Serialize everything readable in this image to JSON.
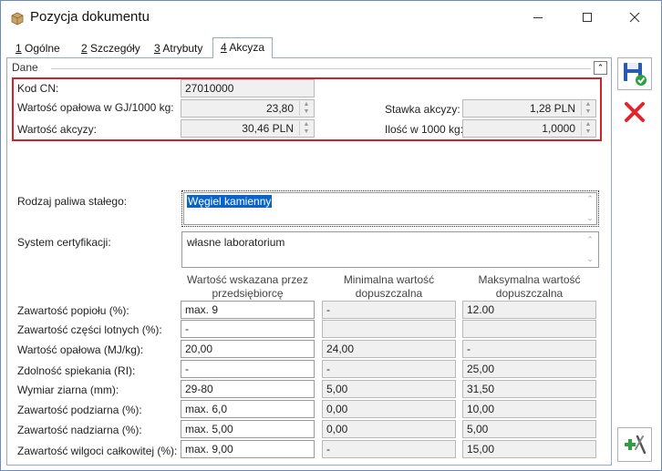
{
  "window": {
    "title": "Pozycja dokumentu"
  },
  "tabs": [
    {
      "key": "1",
      "label": " Ogólne"
    },
    {
      "key": "2",
      "label": " Szczegóły"
    },
    {
      "key": "3",
      "label": " Atrybuty"
    },
    {
      "key": "4",
      "label": " Akcyza"
    }
  ],
  "group": {
    "title": "Dane"
  },
  "excise": {
    "kod_cn_label": "Kod CN:",
    "kod_cn_value": "27010000",
    "wartosc_opalowa_label": "Wartość opałowa w GJ/1000 kg:",
    "wartosc_opalowa_value": "23,80",
    "wartosc_akcyzy_label": "Wartość akcyzy:",
    "wartosc_akcyzy_value": "30,46 PLN",
    "stawka_label": "Stawka akcyzy:",
    "stawka_value": "1,28 PLN",
    "ilosc_label": "Ilość w 1000 kg:",
    "ilosc_value": "1,0000"
  },
  "fuel": {
    "rodzaj_label": "Rodzaj paliwa stałego:",
    "rodzaj_value": "Węgiel kamienny",
    "system_label": "System certyfikacji:",
    "system_value": "własne laboratorium"
  },
  "table": {
    "headers": {
      "col1": "Wartość wskazana przez przedsiębiorcę",
      "col2": "Minimalna wartość dopuszczalna",
      "col3": "Maksymalna wartość dopuszczalna"
    },
    "rows": [
      {
        "label": "Zawartość popiołu (%):",
        "v1": "max. 9",
        "v2": "-",
        "v3": "12.00"
      },
      {
        "label": "Zawartość części lotnych (%):",
        "v1": "-",
        "v2": "",
        "v3": ""
      },
      {
        "label": "Wartość opałowa (MJ/kg):",
        "v1": "20,00",
        "v2": "24,00",
        "v3": "-"
      },
      {
        "label": "Zdolność spiekania (RI):",
        "v1": "-",
        "v2": "-",
        "v3": "25,00"
      },
      {
        "label": "Wymiar ziarna (mm):",
        "v1": "29-80",
        "v2": "5,00",
        "v3": "31,50"
      },
      {
        "label": "Zawartość podziarna (%):",
        "v1": "max. 6,0",
        "v2": "0,00",
        "v3": "10,00"
      },
      {
        "label": "Zawartość nadziarna (%):",
        "v1": "max. 5,00",
        "v2": "0,00",
        "v3": "5,00"
      },
      {
        "label": "Zawartość wilgoci całkowitej (%):",
        "v1": "max. 9,00",
        "v2": "-",
        "v3": "15,00"
      }
    ]
  },
  "icons": {
    "app": "package-icon",
    "save": "save-icon",
    "cancel": "cancel-icon",
    "add": "add-tool-icon"
  },
  "colors": {
    "highlight": "#d42028",
    "selection": "#0a64c8",
    "accent_green": "#2ea043"
  }
}
